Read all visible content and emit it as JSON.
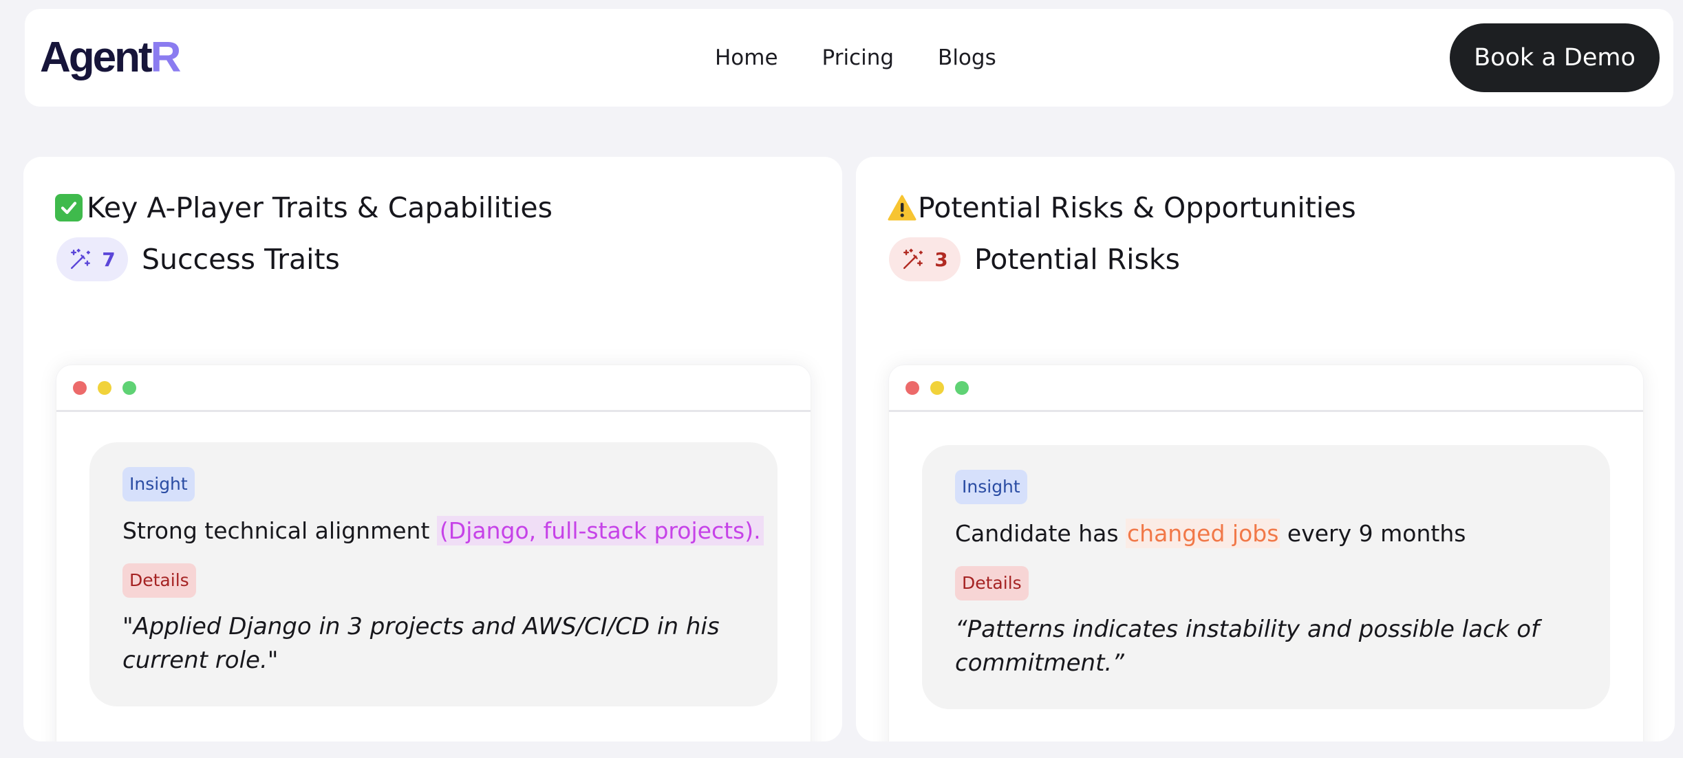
{
  "navbar": {
    "logo_main": "Agent",
    "logo_accent": "R",
    "links": [
      "Home",
      "Pricing",
      "Blogs"
    ],
    "cta_label": "Book a Demo"
  },
  "colors": {
    "page_bg": "#f3f3f7",
    "logo_accent": "#8b7cf0",
    "cta_bg": "#1d1f22",
    "success_accent": "#5b46d8",
    "risk_accent": "#b12a22"
  },
  "traits_panel": {
    "icon": "check-emoji-icon",
    "title": "Key A-Player Traits & Capabilities",
    "count_icon": "magic-wand-icon",
    "count": "7",
    "count_label": "Success Traits",
    "card": {
      "insight_tag": "Insight",
      "insight_text": "Strong technical alignment",
      "insight_highlight": "(Django, full-stack projects).",
      "details_tag": "Details",
      "details_text": "\"Applied Django in 3 projects and AWS/CI/CD in his current role.\""
    }
  },
  "risks_panel": {
    "icon": "warning-emoji-icon",
    "title": "Potential Risks & Opportunities",
    "count_icon": "magic-wand-icon",
    "count": "3",
    "count_label": "Potential Risks",
    "card": {
      "insight_tag": "Insight",
      "insight_text_before": "Candidate has",
      "insight_highlight": "changed jobs",
      "insight_text_after": "every 9 months",
      "details_tag": "Details",
      "details_text": "“Patterns indicates instability and possible lack of commitment.”"
    }
  }
}
